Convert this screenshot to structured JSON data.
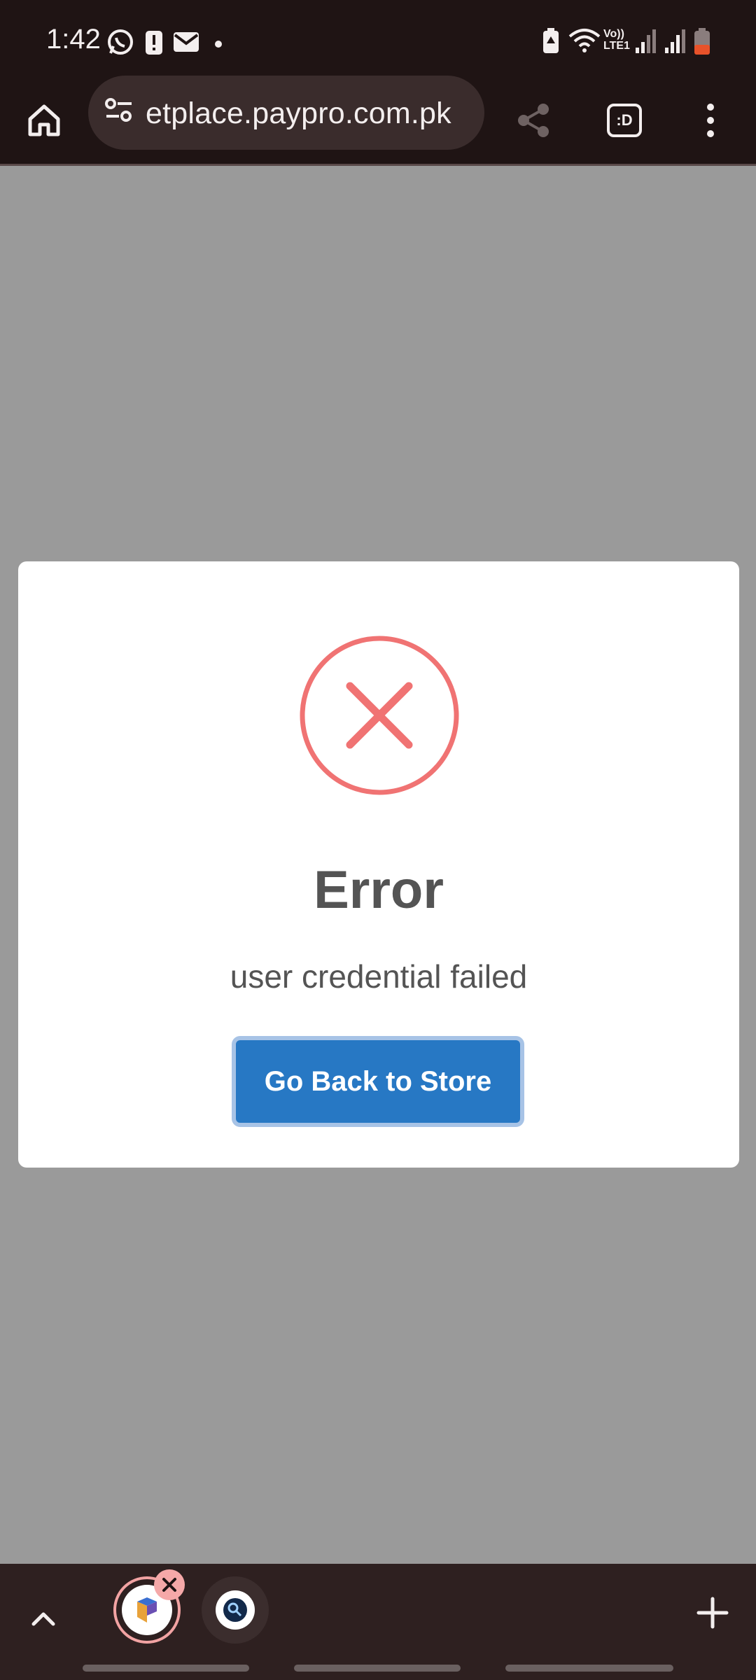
{
  "status_bar": {
    "time": "1:42",
    "left_icons": [
      "whatsapp-icon",
      "alert-icon",
      "mail-icon",
      "dot-icon"
    ],
    "right_icons": [
      "battery-saver-icon",
      "wifi-icon",
      "volte-icon",
      "signal-icon",
      "signal-icon",
      "battery-icon"
    ],
    "volte_label_top": "Vo))",
    "volte_label_bottom": "LTE1",
    "battery_color": "#e8522a"
  },
  "browser": {
    "url": "etplace.paypro.com.pk",
    "tab_button_label": ":D",
    "icons": [
      "home-icon",
      "site-settings-icon",
      "share-icon",
      "tab-switcher-icon",
      "more-vert-icon"
    ]
  },
  "dialog": {
    "title": "Error",
    "message": "user credential failed",
    "button_label": "Go Back to Store",
    "icon": "error-x-icon",
    "accent_color": "#f07373",
    "button_color": "#2778c4"
  },
  "tab_strip": {
    "icons": [
      "chevron-up-icon",
      "close-icon",
      "plus-icon"
    ],
    "tabs": [
      {
        "name": "paypro-tab",
        "active": true
      },
      {
        "name": "search-tab",
        "active": false
      }
    ]
  }
}
